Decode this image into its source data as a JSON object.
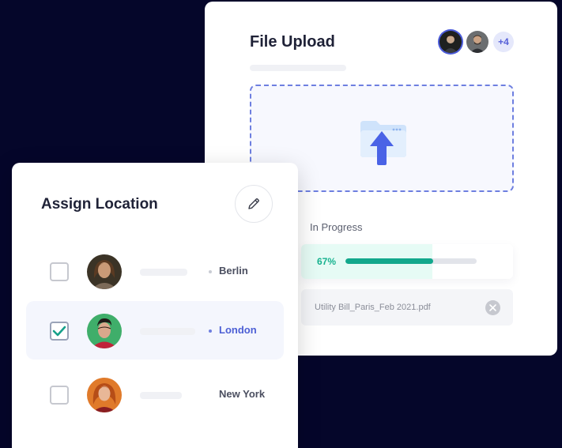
{
  "upload": {
    "title": "File Upload",
    "avatars": [
      {
        "icon": "person-avatar",
        "color": "#1e2120"
      },
      {
        "icon": "person-avatar",
        "color": "#6b6e70"
      }
    ],
    "more_count": "+4",
    "dropzone_icon": "folder-upload-icon",
    "progress": {
      "label": "In Progress",
      "percent_text": "67%",
      "fraction": 0.67
    },
    "file": {
      "name": "Utility Bill_Paris_Feb 2021.pdf",
      "remove_icon": "close-icon"
    }
  },
  "assign": {
    "title": "Assign Location",
    "edit_icon": "pencil-icon",
    "rows": [
      {
        "location": "Berlin",
        "checked": false,
        "dot_color": "#c9ccd4"
      },
      {
        "location": "London",
        "checked": true,
        "dot_color": "#6f7fe0"
      },
      {
        "location": "New York",
        "checked": false,
        "dot_color": null
      }
    ]
  },
  "colors": {
    "background": "#05062a",
    "accent": "#4c5fd5",
    "progress": "#12a88c",
    "check": "#17a08a"
  }
}
